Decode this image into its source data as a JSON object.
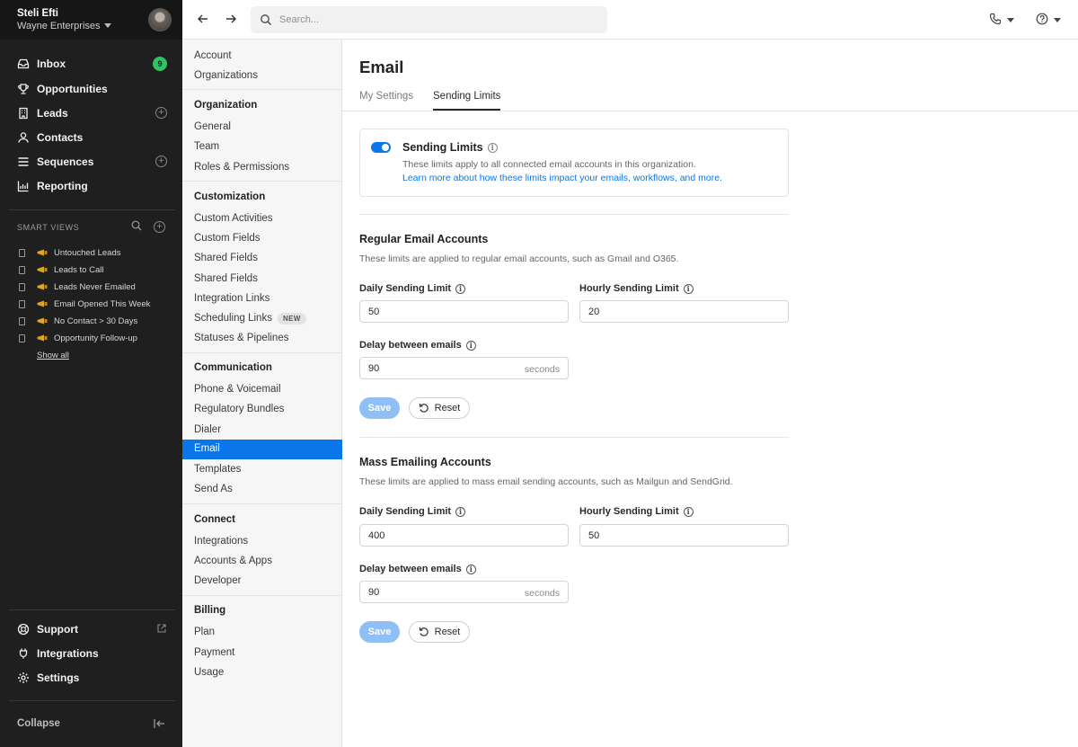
{
  "user": {
    "name": "Steli Efti",
    "organization": "Wayne Enterprises"
  },
  "nav": {
    "items": [
      {
        "label": "Inbox",
        "badge": "9"
      },
      {
        "label": "Opportunities"
      },
      {
        "label": "Leads"
      },
      {
        "label": "Contacts"
      },
      {
        "label": "Sequences"
      },
      {
        "label": "Reporting"
      }
    ],
    "smart_views_title": "SMART VIEWS",
    "smart_views": [
      "Untouched Leads",
      "Leads to Call",
      "Leads Never Emailed",
      "Email Opened This Week",
      "No Contact > 30 Days",
      "Opportunity Follow-up"
    ],
    "show_all": "Show all",
    "bottom": [
      {
        "label": "Support"
      },
      {
        "label": "Integrations"
      },
      {
        "label": "Settings"
      }
    ],
    "collapse": "Collapse"
  },
  "search": {
    "placeholder": "Search..."
  },
  "settings_menu": {
    "top": [
      "Account",
      "Organizations"
    ],
    "sections": [
      {
        "title": "Organization",
        "items": [
          "General",
          "Team",
          "Roles & Permissions"
        ]
      },
      {
        "title": "Customization",
        "items": [
          "Custom Activities",
          "Custom Fields",
          "Shared Fields",
          "Shared Fields",
          "Integration Links",
          "Scheduling Links",
          "Statuses & Pipelines"
        ]
      },
      {
        "title": "Communication",
        "items": [
          "Phone & Voicemail",
          "Regulatory Bundles",
          "Dialer",
          "Email",
          "Templates",
          "Send As"
        ]
      },
      {
        "title": "Connect",
        "items": [
          "Integrations",
          "Accounts & Apps",
          "Developer"
        ]
      },
      {
        "title": "Billing",
        "items": [
          "Plan",
          "Payment",
          "Usage"
        ]
      }
    ],
    "new_badge": "NEW",
    "active": "Email"
  },
  "page": {
    "title": "Email",
    "tabs": [
      "My Settings",
      "Sending Limits"
    ],
    "active_tab": "Sending Limits",
    "limits_card": {
      "title": "Sending Limits",
      "enabled": true,
      "description": "These limits apply to all connected email accounts in this organization.",
      "link": "Learn more about how these limits impact your emails, workflows, and more."
    },
    "regular": {
      "title": "Regular Email Accounts",
      "description": "These limits are applied to regular email accounts, such as Gmail and O365.",
      "daily_label": "Daily Sending Limit",
      "daily_value": "50",
      "hourly_label": "Hourly Sending Limit",
      "hourly_value": "20",
      "delay_label": "Delay between emails",
      "delay_value": "90",
      "delay_unit": "seconds",
      "save": "Save",
      "reset": "Reset"
    },
    "mass": {
      "title": "Mass Emailing Accounts",
      "description": "These limits are applied to mass email sending accounts, such as Mailgun and SendGrid.",
      "daily_label": "Daily Sending Limit",
      "daily_value": "400",
      "hourly_label": "Hourly Sending Limit",
      "hourly_value": "50",
      "delay_label": "Delay between emails",
      "delay_value": "90",
      "delay_unit": "seconds",
      "save": "Save",
      "reset": "Reset"
    }
  },
  "colors": {
    "accent": "#0a76e8",
    "sidebar": "#1f1f1f",
    "badge": "#2ec363",
    "save_disabled": "#8ec0f6"
  }
}
